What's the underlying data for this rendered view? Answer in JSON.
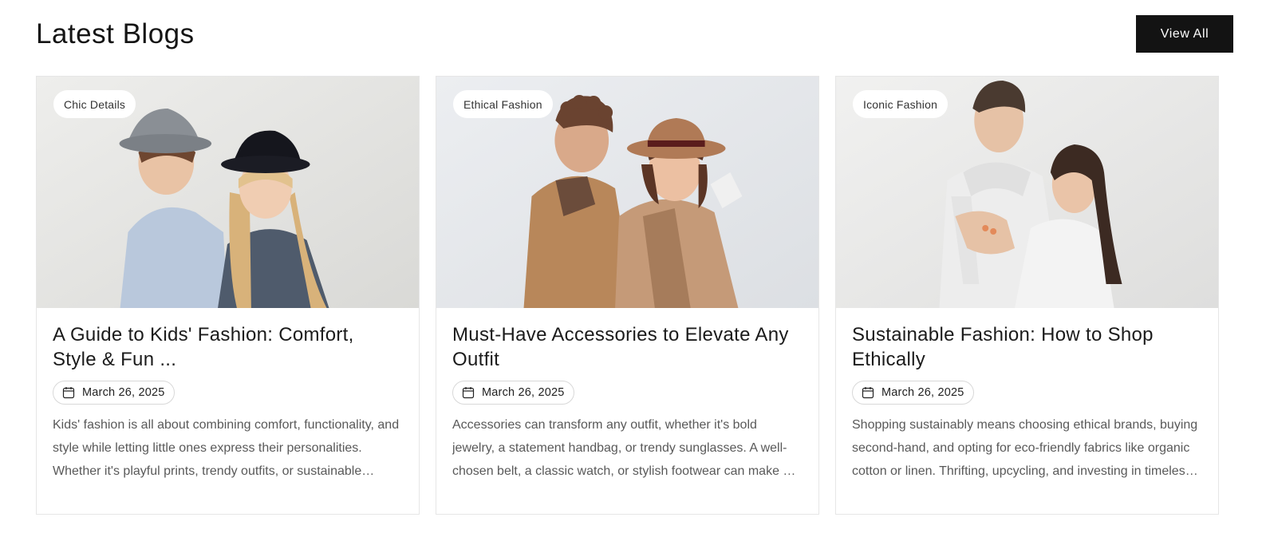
{
  "section": {
    "title": "Latest Blogs",
    "view_all_label": "View All"
  },
  "cards": [
    {
      "tag": "Chic Details",
      "title": "A Guide to Kids' Fashion: Comfort, Style & Fun ...",
      "date": "March 26, 2025",
      "excerpt": "Kids' fashion is all about combining comfort, functionality, and style while letting little ones express their personalities. Whether it's playful prints, trendy outfits, or sustainable choices, there is something for everyone.",
      "image_icon": "photo-kids-in-hats"
    },
    {
      "tag": "Ethical Fashion",
      "title": "Must-Have Accessories to Elevate Any Outfit",
      "date": "March 26, 2025",
      "excerpt": "Accessories can transform any outfit, whether it's bold jewelry, a statement handbag, or trendy sunglasses. A well-chosen belt, a classic watch, or stylish footwear can make a difference.",
      "image_icon": "photo-couple-in-coats"
    },
    {
      "tag": "Iconic Fashion",
      "title": "Sustainable Fashion: How to Shop Ethically",
      "date": "March 26, 2025",
      "excerpt": "Shopping sustainably means choosing ethical brands, buying second-hand, and opting for eco-friendly fabrics like organic cotton or linen. Thrifting, upcycling, and investing in timeless pieces helps.",
      "image_icon": "photo-couple-in-hoodies"
    }
  ],
  "colors": {
    "button_bg": "#131313",
    "card_border": "#e6e6e6",
    "excerpt_text": "#595959"
  }
}
